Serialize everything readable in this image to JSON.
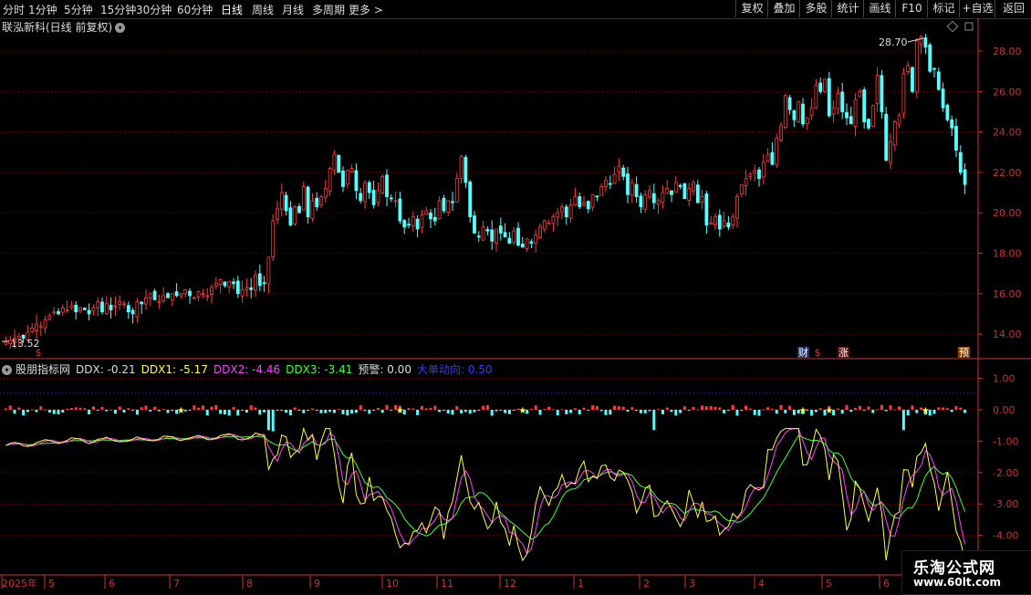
{
  "toolbar": {
    "timeframes": [
      "分时",
      "1分钟",
      "5分钟",
      "15分钟",
      "30分钟",
      "60分钟",
      "日线",
      "周线",
      "月线",
      "多周期",
      "更多 >"
    ],
    "active_timeframe": "日线",
    "right_buttons": [
      "复权",
      "叠加",
      "多股",
      "统计",
      "画线",
      "F10",
      "标记",
      "+自选",
      "返回"
    ]
  },
  "stock": {
    "title": "联泓新科(日线 前复权)",
    "high_label": "28.70",
    "low_label": "13.52"
  },
  "markers": {
    "cai": "财",
    "dollar": "$",
    "zhang": "涨",
    "yu": "预"
  },
  "indicator": {
    "name": "股朋指标网",
    "ddx": "DDX: -0.21",
    "ddx1": "DDX1: -5.17",
    "ddx2": "DDX2: -4.46",
    "ddx3": "DDX3: -3.41",
    "warn": "预警: 0.00",
    "dadan": "大单动向: 0.50"
  },
  "price_axis": [
    "28.00",
    "26.00",
    "24.00",
    "22.00",
    "20.00",
    "18.00",
    "16.00",
    "14.00"
  ],
  "ind_axis": [
    "1.00",
    "0.00",
    "-1.00",
    "-2.00",
    "-3.00",
    "-4.00"
  ],
  "date_axis": [
    "2025年",
    "5",
    "6",
    "7",
    "8",
    "9",
    "10",
    "11",
    "12",
    "1",
    "2",
    "3",
    "4",
    "5",
    "6"
  ],
  "watermark": {
    "line1": "乐淘公式网",
    "line2": "www.60lt.com"
  },
  "colors": {
    "up": "#ff3c3c",
    "down": "#54ffff",
    "ddx1": "#ffff40",
    "ddx2": "#ff40ff",
    "ddx3": "#40ff40",
    "grid": "#7a0000",
    "axis": "#c33"
  },
  "chart_data": {
    "type": "candlestick",
    "ylim": [
      13,
      29.5
    ],
    "close": [
      13.6,
      13.7,
      13.8,
      13.9,
      13.8,
      14.1,
      14.3,
      14.5,
      14.4,
      14.7,
      14.9,
      15.1,
      15.0,
      15.3,
      15.2,
      15.4,
      15.1,
      15.3,
      15.2,
      15.0,
      15.3,
      15.6,
      15.1,
      15.5,
      15.2,
      15.4,
      15.6,
      15.5,
      15.1,
      15.0,
      15.6,
      15.5,
      15.8,
      16.0,
      15.7,
      15.6,
      15.9,
      15.8,
      16.0,
      15.9,
      16.0,
      16.2,
      15.9,
      15.8,
      16.1,
      16.0,
      15.9,
      16.3,
      16.5,
      16.7,
      16.4,
      16.6,
      16.5,
      16.0,
      16.2,
      16.3,
      16.2,
      16.9,
      16.4,
      16.5,
      17.8,
      19.6,
      20.2,
      21.0,
      20.1,
      19.4,
      20.3,
      20.0,
      21.3,
      19.8,
      20.6,
      20.3,
      20.8,
      21.2,
      22.2,
      22.9,
      22.0,
      21.3,
      22.1,
      22.2,
      21.1,
      20.6,
      21.5,
      21.0,
      20.4,
      21.1,
      21.8,
      20.8,
      20.7,
      20.6,
      19.6,
      19.3,
      19.4,
      19.8,
      19.2,
      19.9,
      20.1,
      19.7,
      19.6,
      20.6,
      20.1,
      20.6,
      20.5,
      21.7,
      22.8,
      21.5,
      19.8,
      19.0,
      18.8,
      19.3,
      19.1,
      18.6,
      19.2,
      19.0,
      18.8,
      18.5,
      19.1,
      18.4,
      18.3,
      18.7,
      18.5,
      18.9,
      19.3,
      19.6,
      19.5,
      19.8,
      20.0,
      20.3,
      19.8,
      20.4,
      20.8,
      20.3,
      20.5,
      20.2,
      20.9,
      20.8,
      21.3,
      21.6,
      21.4,
      21.9,
      22.3,
      21.8,
      20.9,
      21.5,
      20.8,
      20.3,
      20.9,
      21.1,
      20.5,
      20.6,
      21.0,
      21.2,
      20.9,
      21.5,
      21.3,
      20.7,
      21.2,
      21.5,
      20.5,
      20.8,
      19.4,
      19.5,
      19.8,
      19.2,
      19.6,
      19.3,
      19.8,
      20.8,
      21.4,
      21.7,
      21.9,
      22.1,
      21.7,
      22.5,
      22.9,
      22.4,
      23.7,
      24.3,
      25.8,
      25.1,
      24.6,
      25.5,
      24.4,
      24.7,
      25.2,
      26.3,
      26.0,
      26.6,
      24.8,
      25.2,
      25.9,
      25.0,
      24.7,
      24.4,
      25.6,
      26.0,
      24.5,
      24.2,
      25.3,
      26.8,
      25.0,
      22.6,
      23.5,
      24.5,
      24.8,
      26.9,
      27.3,
      26.0,
      28.5,
      28.7,
      28.2,
      27.0,
      27.1,
      26.1,
      25.2,
      24.6,
      24.2,
      23.1,
      22.0,
      21.4
    ]
  }
}
